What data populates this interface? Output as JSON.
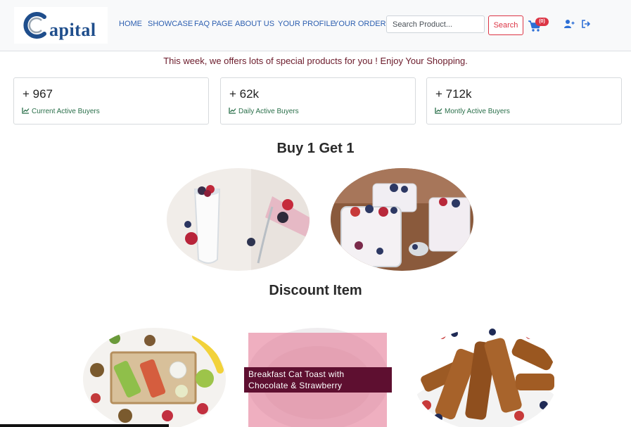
{
  "brand": {
    "logo_text": "apital",
    "logo_alt": "Capital"
  },
  "nav": {
    "links": [
      "HOME",
      "SHOWCASE",
      "FAQ PAGE",
      "ABOUT US",
      "YOUR PROFILE",
      "YOUR ORDERS"
    ]
  },
  "search": {
    "placeholder": "Search Product...",
    "button_label": "Search"
  },
  "cart": {
    "badge": "(0)"
  },
  "promo_text": "This week, we offers lots of special products for you ! Enjoy Your Shopping.",
  "stats": [
    {
      "value": "+ 967",
      "label": "Current Active Buyers"
    },
    {
      "value": "+ 62k",
      "label": "Daily Active Buyers"
    },
    {
      "value": "+ 712k",
      "label": "Montly Active Buyers"
    }
  ],
  "sections": {
    "bogo_title": "Buy 1 Get 1",
    "discount_title": "Discount Item"
  },
  "discount_overlay": {
    "line1": "Breakfast Cat Toast with",
    "line2": "Chocolate & Strawberry"
  },
  "colors": {
    "nav_link": "#2d5fb0",
    "search_button": "#dc3545",
    "promo_text": "#6b1a2a",
    "stat_label": "#2a6f4a",
    "overlay_label_bg": "#5e0f30"
  }
}
